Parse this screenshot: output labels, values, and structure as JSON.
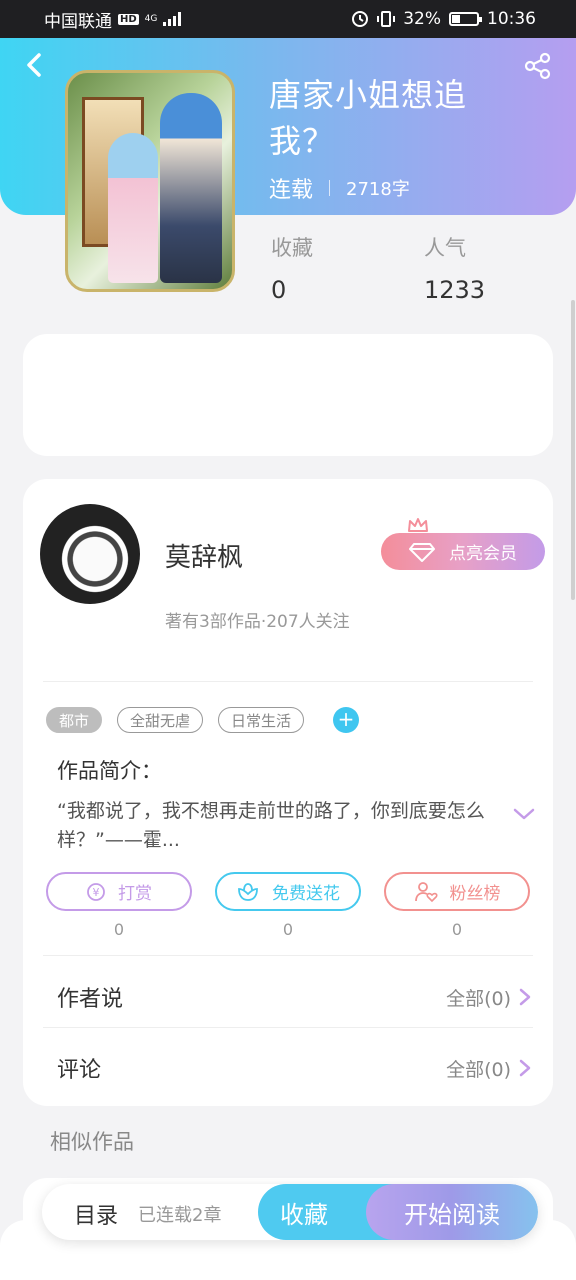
{
  "status_bar": {
    "carrier": "中国联通",
    "hd": "HD",
    "network": "4G",
    "battery_percent": "32%",
    "time": "10:36",
    "battery_level": 0.32
  },
  "book": {
    "title": "唐家小姐想追我？",
    "status": "连载",
    "word_count": "2718字",
    "stats": [
      {
        "label": "收藏",
        "value": "0"
      },
      {
        "label": "人气",
        "value": "1233"
      }
    ]
  },
  "author": {
    "name": "莫辞枫",
    "info": "著有3部作品·207人关注",
    "vip_button": "点亮会员"
  },
  "tags": [
    "都市",
    "全甜无虐",
    "日常生活"
  ],
  "intro": {
    "title": "作品简介：",
    "text": "“我都说了，我不想再走前世的路了，你到底要怎么样？”——霍..."
  },
  "actions": [
    {
      "label": "打赏",
      "count": "0",
      "color": "#c49be8"
    },
    {
      "label": "免费送花",
      "count": "0",
      "color": "#45c9ee"
    },
    {
      "label": "粉丝榜",
      "count": "0",
      "color": "#f2918f"
    }
  ],
  "rows": [
    {
      "label": "作者说",
      "value": "全部(0)"
    },
    {
      "label": "评论",
      "value": "全部(0)"
    }
  ],
  "similar": {
    "title": "相似作品"
  },
  "bottom_bar": {
    "toc_label": "目录",
    "toc_sub": "已连载2章",
    "favorite": "收藏",
    "start_reading": "开始阅读"
  },
  "colors": {
    "accent_cyan": "#3fd5f3",
    "accent_purple": "#b59ef0",
    "vip_pink": "#f48e9a"
  }
}
